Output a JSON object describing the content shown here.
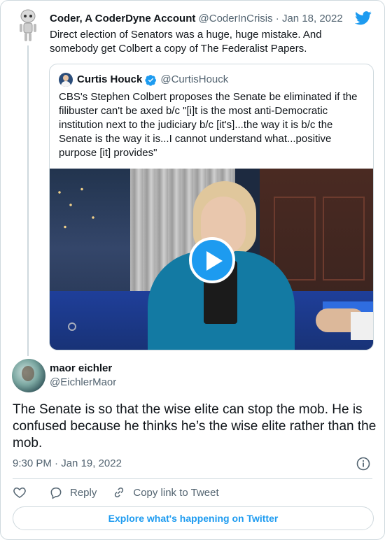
{
  "parent_tweet": {
    "author_name": "Coder, A CoderDyne Account",
    "handle": "@CoderInCrisis",
    "separator": "·",
    "date": "Jan 18, 2022",
    "text": "Direct election of Senators was a huge, huge mistake. And somebody get Colbert a copy of The Federalist Papers."
  },
  "quoted_tweet": {
    "author_name": "Curtis Houck",
    "handle": "@CurtisHouck",
    "verified": true,
    "text": "CBS's Stephen Colbert proposes the Senate be eliminated if the filibuster can't be axed b/c \"[i]t is the most anti-Democratic institution next to the judiciary b/c [it's]...the way it is b/c the Senate is the way it is...I cannot understand what...positive purpose [it] provides\""
  },
  "main_tweet": {
    "author_name": "maor eichler",
    "handle": "@EichlerMaor",
    "text": "The Senate is so that the wise elite can stop the mob. He is confused because he thinks he’s the wise elite rather than the mob.",
    "time": "9:30 PM",
    "separator": "·",
    "date": "Jan 19, 2022"
  },
  "actions": {
    "like_icon": "heart-icon",
    "reply_label": "Reply",
    "copy_link_label": "Copy link to Tweet"
  },
  "explore_label": "Explore what's happening on Twitter",
  "colors": {
    "accent": "#1d9bf0",
    "text_primary": "#0f1419",
    "text_secondary": "#536471",
    "border": "#cfd9de"
  }
}
